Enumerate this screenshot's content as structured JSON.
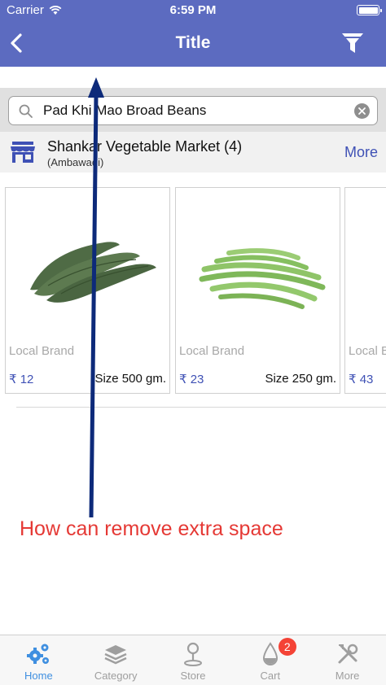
{
  "status_bar": {
    "carrier": "Carrier",
    "time": "6:59 PM"
  },
  "nav": {
    "title": "Title"
  },
  "search": {
    "query": "Pad Khi Mao Broad Beans"
  },
  "store": {
    "name": "Shankar Vegetable Market (4)",
    "area": "(Ambawadi)",
    "more_label": "More"
  },
  "products": [
    {
      "brand": "Local Brand",
      "price": "₹ 12",
      "size": "Size 500 gm.",
      "image": "broad-beans-photo"
    },
    {
      "brand": "Local Brand",
      "price": "₹ 23",
      "size": "Size 250 gm.",
      "image": "green-beans-photo"
    },
    {
      "brand": "Local Brand",
      "price": "₹ 43",
      "size": "",
      "image": ""
    }
  ],
  "annotation": {
    "text": "How can remove  extra space"
  },
  "tabs": [
    {
      "label": "Home",
      "icon": "gears-icon",
      "active": true
    },
    {
      "label": "Category",
      "icon": "layers-icon",
      "active": false
    },
    {
      "label": "Store",
      "icon": "map-pin-icon",
      "active": false
    },
    {
      "label": "Cart",
      "icon": "cart-bag-icon",
      "active": false,
      "badge": "2"
    },
    {
      "label": "More",
      "icon": "tools-icon",
      "active": false
    }
  ],
  "colors": {
    "nav": "#5c6bc0",
    "accent": "#3f51b5",
    "annotation": "#e53935",
    "arrow": "#0d2a7a",
    "badge": "#f44336"
  }
}
